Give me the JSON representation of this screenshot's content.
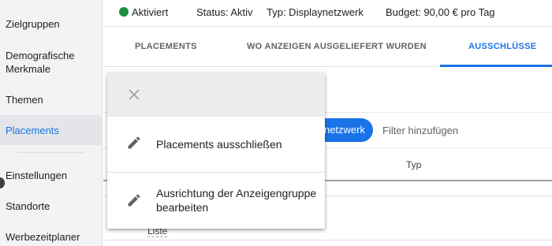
{
  "sidebar": {
    "items": [
      {
        "label": "Zielgruppen"
      },
      {
        "label": "Demografische Merkmale"
      },
      {
        "label": "Themen"
      },
      {
        "label": "Placements"
      },
      {
        "label": "Einstellungen"
      },
      {
        "label": "Standorte"
      },
      {
        "label": "Werbezeitplaner"
      }
    ],
    "active_index": 3
  },
  "status": {
    "state": "Aktiviert",
    "status_text": "Status: Aktiv",
    "type_text": "Typ: Displaynetzwerk",
    "budget_text": "Budget: 90,00 € pro Tag",
    "state_color": "#1e8e3e"
  },
  "tabs": [
    {
      "label": "PLACEMENTS"
    },
    {
      "label": "WO ANZEIGEN AUSGELIEFERT WURDEN"
    },
    {
      "label": "AUSSCHLÜSSE"
    }
  ],
  "filter": {
    "chip_label": "netzwerk",
    "add_filter": "Filter hinzufügen"
  },
  "table": {
    "columns": [
      "Typ"
    ],
    "partial_cell": "Liste"
  },
  "menu": {
    "close_icon": "close-icon",
    "items": [
      {
        "label": "Placements ausschließen",
        "icon": "pencil-icon"
      },
      {
        "label": "Ausrichtung der Anzeigengruppe bearbeiten",
        "icon": "pencil-icon"
      }
    ]
  },
  "colors": {
    "accent": "#1a73e8",
    "active_status": "#1e8e3e"
  }
}
